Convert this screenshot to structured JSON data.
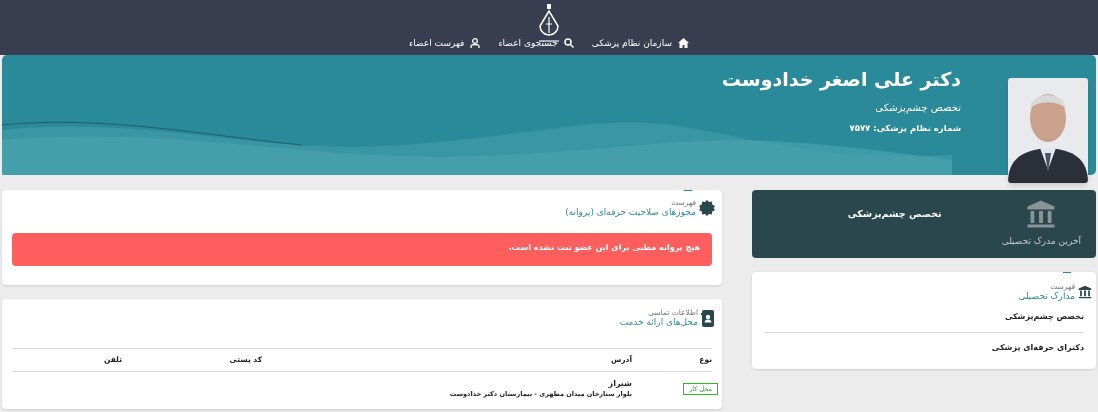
{
  "nav": {
    "items": [
      {
        "label": "سازمان نظام پزشکی",
        "kind": "home"
      },
      {
        "label": "جستجوی اعضاء",
        "kind": "search"
      },
      {
        "label": "فهرست اعضاء",
        "kind": "members"
      }
    ]
  },
  "profile": {
    "name": "دکتر علی اصغر خدادوست",
    "specialty": "تخصص چشم‌پزشکی",
    "license": "شماره نظام پزشکی: ۷۵۷۷"
  },
  "latest_degree": {
    "value": "تخصص چشم‌پزشکی",
    "caption": "آخرین مدرک تحصیلی"
  },
  "degrees": {
    "overline": "فهرست",
    "title": "مدارک تحصیلی",
    "items": [
      "تخصص چشم‌پزشکی",
      "دکترای حرفه‌ای پزشکی"
    ]
  },
  "licenses": {
    "overline": "فهرست",
    "title": "مجوزهای صلاحیت حرفه‌ای (پروانه)",
    "alert": "هیچ پروانه مطبی برای این عضو ثبت نشده است."
  },
  "locations": {
    "overline": "اطلاعات تماسی",
    "title": "محل‌های ارائه خدمت",
    "columns": [
      "نوع",
      "آدرس",
      "کد پستی",
      "تلفن"
    ],
    "rows": [
      {
        "type": "محل کار",
        "city": "شیراز",
        "address": "بلوار ستارخان میدان مطهری - بیمارستان دکتر خدادوست"
      }
    ]
  }
}
